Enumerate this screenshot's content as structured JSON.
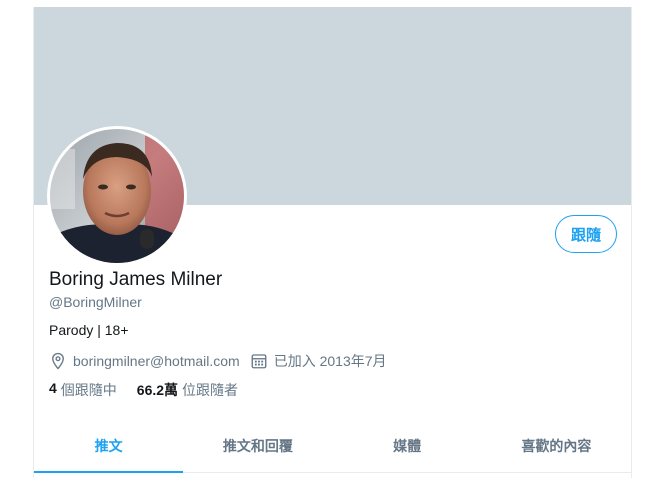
{
  "profile": {
    "name": "Boring James Milner",
    "handle": "@BoringMilner",
    "bio": "Parody | 18+",
    "website": "boringmilner@hotmail.com",
    "joined": "已加入 2013年7月",
    "follow_label": "跟隨",
    "following_count": "4",
    "following_label": "個跟隨中",
    "followers_count": "66.2萬",
    "followers_label": "位跟隨者"
  },
  "tabs": [
    {
      "label": "推文"
    },
    {
      "label": "推文和回覆"
    },
    {
      "label": "媒體"
    },
    {
      "label": "喜歡的內容"
    }
  ],
  "colors": {
    "accent": "#1da1f2",
    "banner": "#ccd6dd",
    "secondary_text": "#657786"
  },
  "icons": {
    "location": "location-pin-icon",
    "calendar": "calendar-icon"
  }
}
